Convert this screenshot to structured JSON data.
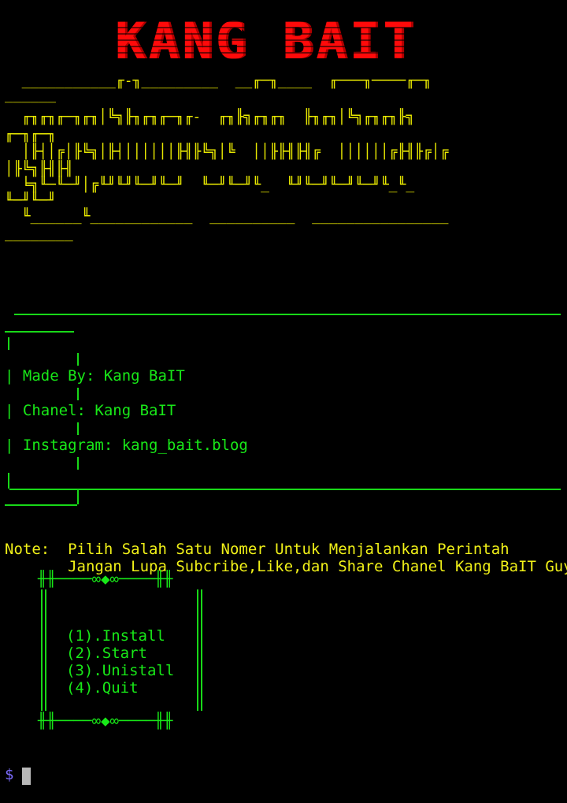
{
  "banner": {
    "title": "KANG BAIT"
  },
  "ascii_art": {
    "lines": [
      "  ___________╓-╖_________  __╓─╖____  ╓───╖────╓─╖",
      "______",
      "  ╓╖╓╖╓─╖╓╖│╚╗╟╖╓╖╓─╖╓-  ╓╖╟╗╓╖╓╖  ╟╖╓╖│╚╗╓╖╓╖╟╗",
      "╓─╖╓─╖",
      "  │╟┤│╔│╟╚╗│╟┤││││││╟╢╟╚╗│╚  ││╟╟╢╟╢╔  ││││││╔╟╢╟╔│╔",
      "│╟╚╗╟╢╟╢",
      "  ╘╗╙─╙─╜│╔╙╜╙╜╙─╜╙─╜  ╙─╜╙─╜╙_  ╙╜╙─╜╙─╜╙─╜╙_╙_",
      "╙─╜╙─╜",
      "  ╙______╙____________  __________  ________________",
      "________"
    ]
  },
  "info_box": {
    "made_by": "| Made By: Kang BaIT",
    "chanel": "| Chanel: Kang BaIT",
    "instagram": "| Instagram: kang_bait.blog"
  },
  "note": {
    "line1": "Note:  Pilih Salah Satu Nomer Untuk Menjalankan Perintah",
    "line2": "       Jangan Lupa Subcribe,Like,dan Share Chanel Kang BaIT Guys"
  },
  "menu": {
    "top": "╫╫────∞◆∞────╫╫",
    "items": [
      "(1).Install",
      "(2).Start",
      "(3).Unistall",
      "(4).Quit"
    ],
    "bottom": "╫╫────∞◆∞────╫╫"
  },
  "prompt": {
    "symbol": "$"
  }
}
